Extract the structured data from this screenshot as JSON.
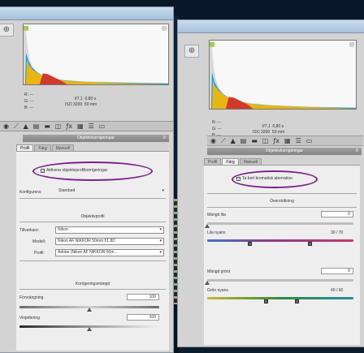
{
  "left_panel": {
    "rgb": {
      "r_label": "R:",
      "g_label": "G:",
      "b_label": "B:",
      "r": "---",
      "g": "---",
      "b": "---"
    },
    "exposure": {
      "aperture": "f/7,1",
      "shutter": "0,80 s",
      "iso": "ISO 3200",
      "focal": "50 mm"
    },
    "toolbar_icons": [
      "basic-icon",
      "tone-curve-icon",
      "detail-icon",
      "hsl-icon",
      "split-toning-icon",
      "lens-corrections-icon",
      "effects-icon",
      "camera-calibration-icon",
      "presets-icon",
      "snapshots-icon"
    ],
    "section_title": "Objektivkorrigeringar",
    "tabs": [
      "Profil",
      "Färg",
      "Manuell"
    ],
    "active_tab": 0,
    "enable_profile_label": "Aktivera objektivprofilkorrigeringar",
    "enable_profile_checked": true,
    "setup_label": "Konfigurera:",
    "setup_value": "Standard",
    "lens_profile_header": "Objektivprofil",
    "make_label": "Tillverkare:",
    "make_value": "Nikon",
    "model_label": "Modell:",
    "model_value": "Nikon AF NIKKOR 50mm f/1.8D",
    "profile_label": "Profil:",
    "profile_value": "Adobe (Nikon AF NIKKOR 50m...",
    "correction_header": "Korrigeringsmängd",
    "distortion_label": "Förvrängning",
    "distortion_value": "100",
    "distortion_level": 0.5,
    "vignetting_label": "Vinjettering",
    "vignetting_value": "100",
    "vignetting_level": 0.5
  },
  "right_panel": {
    "rgb": {
      "r_label": "R:",
      "g_label": "G:",
      "b_label": "B:",
      "r": "---",
      "g": "---",
      "b": "---"
    },
    "exposure": {
      "aperture": "f/7,1",
      "shutter": "0,80 s",
      "iso": "ISO 3200",
      "focal": "50 mm"
    },
    "section_title": "Objektivkorrigeringar",
    "tabs": [
      "Profil",
      "Färg",
      "Manuell"
    ],
    "active_tab": 1,
    "remove_ca_label": "Ta bort kromatisk aberration",
    "remove_ca_checked": true,
    "defringe_header": "Överstrålning",
    "purple_amount_label": "Mängd lila",
    "purple_amount_value": "0",
    "purple_hue_label": "Lila nyans",
    "purple_hue_value": "30 / 70",
    "green_amount_label": "Mängd grönt",
    "green_amount_value": "0",
    "green_hue_label": "Grön nyans",
    "green_hue_value": "40 / 60"
  },
  "colors": {
    "panel_bg": "#d3d3d3",
    "content_bg": "#eeeeee",
    "highlight_ring": "#7a1f8a",
    "section_header": "#8f8f8f",
    "purple_slider": "#8a3b8a",
    "green_slider": "#2f8a3b"
  }
}
